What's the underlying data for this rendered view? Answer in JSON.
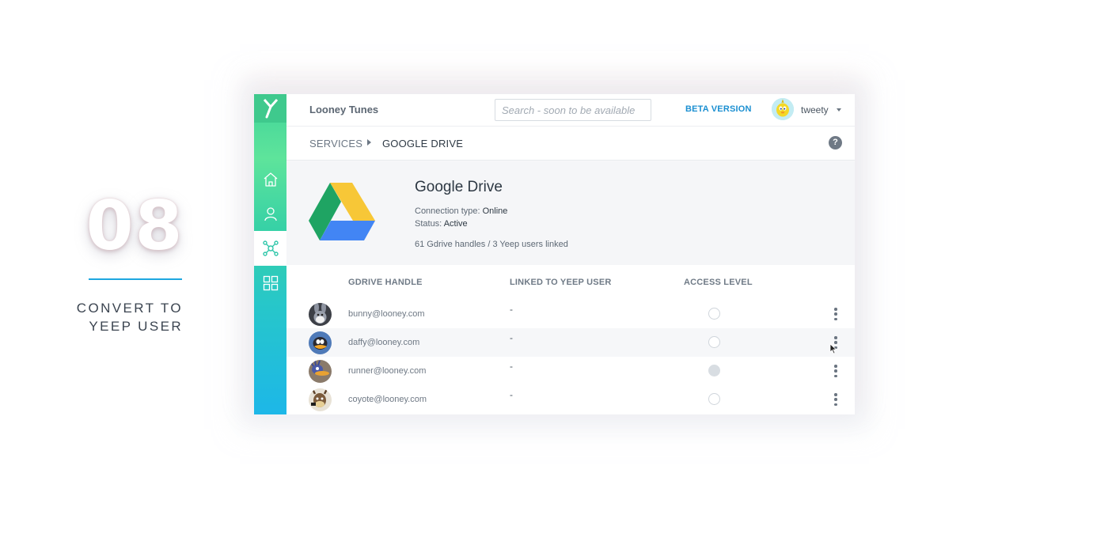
{
  "step": {
    "number": "08",
    "caption_line1": "CONVERT TO",
    "caption_line2": "YEEP USER"
  },
  "colors": {
    "accent": "#1ea7e0",
    "rail_top": "#3fd39a",
    "rail_bottom": "#1db7e8",
    "beta_link": "#1b8fd1"
  },
  "topbar": {
    "org_name": "Looney Tunes",
    "search_placeholder": "Search - soon to be available",
    "beta_label": "BETA VERSION",
    "username": "tweety"
  },
  "sidebar": {
    "items": [
      {
        "icon": "home-icon"
      },
      {
        "icon": "user-icon"
      },
      {
        "icon": "network-icon",
        "active": true
      },
      {
        "icon": "grid-icon"
      }
    ]
  },
  "breadcrumb": {
    "parent": "SERVICES",
    "current": "GOOGLE DRIVE",
    "help": "?"
  },
  "service": {
    "title": "Google Drive",
    "connection_label": "Connection type:",
    "connection_value": "Online",
    "status_label": "Status:",
    "status_value": "Active",
    "summary": "61 Gdrive handles / 3 Yeep users linked"
  },
  "table": {
    "headers": [
      "GDRIVE HANDLE",
      "LINKED TO YEEP USER",
      "ACCESS LEVEL"
    ],
    "rows": [
      {
        "handle": "bunny@looney.com",
        "linked": "-",
        "access_checked": false
      },
      {
        "handle": "daffy@looney.com",
        "linked": "-",
        "access_checked": false
      },
      {
        "handle": "runner@looney.com",
        "linked": "-",
        "access_checked": true
      },
      {
        "handle": "coyote@looney.com",
        "linked": "-",
        "access_checked": false
      }
    ]
  }
}
